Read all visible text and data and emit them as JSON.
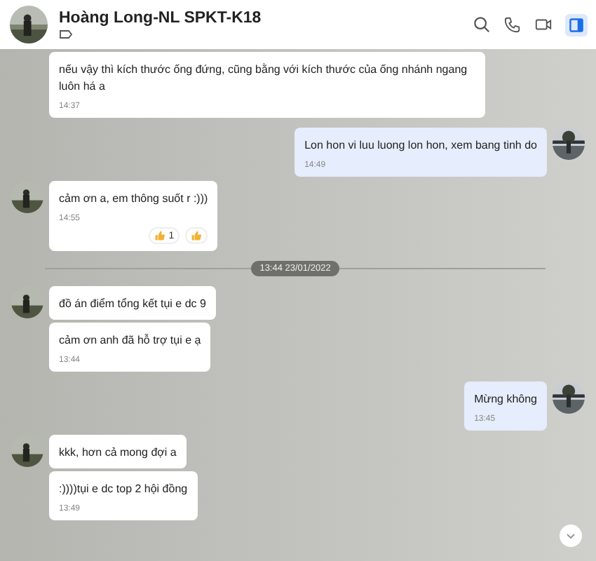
{
  "header": {
    "name": "Hoàng Long-NL SPKT-K18",
    "panel_open": true
  },
  "messages": [
    {
      "kind": "received",
      "avatar": false,
      "text": "nếu vậy thì kích thước ống đứng, cũng bằng với kích thước của ống nhánh ngang luôn há a",
      "time": "14:37"
    },
    {
      "kind": "sent",
      "avatar": true,
      "text": "Lon hon vi luu luong lon hon, xem bang tinh do",
      "time": "14:49"
    },
    {
      "kind": "received",
      "avatar": true,
      "text": "cảm ơn a, em thông suốt r :)))",
      "time": "14:55",
      "reactions": [
        {
          "kind": "count",
          "count": "1"
        },
        {
          "kind": "add"
        }
      ]
    },
    {
      "kind": "divider",
      "text": "13:44 23/01/2022"
    },
    {
      "kind": "received",
      "avatar": true,
      "text": "đồ án điểm tổng kết tụi e dc 9"
    },
    {
      "kind": "received",
      "avatar": false,
      "text": "cảm ơn anh đã hỗ trợ tụi e ạ",
      "time": "13:44"
    },
    {
      "kind": "sent",
      "avatar": true,
      "text": "Mừng không",
      "time": "13:45"
    },
    {
      "kind": "received",
      "avatar": true,
      "text": "kkk, hơn cả mong đợi a"
    },
    {
      "kind": "received",
      "avatar": false,
      "text": ":))))tụi e dc top 2 hội đồng",
      "time": "13:49"
    }
  ]
}
